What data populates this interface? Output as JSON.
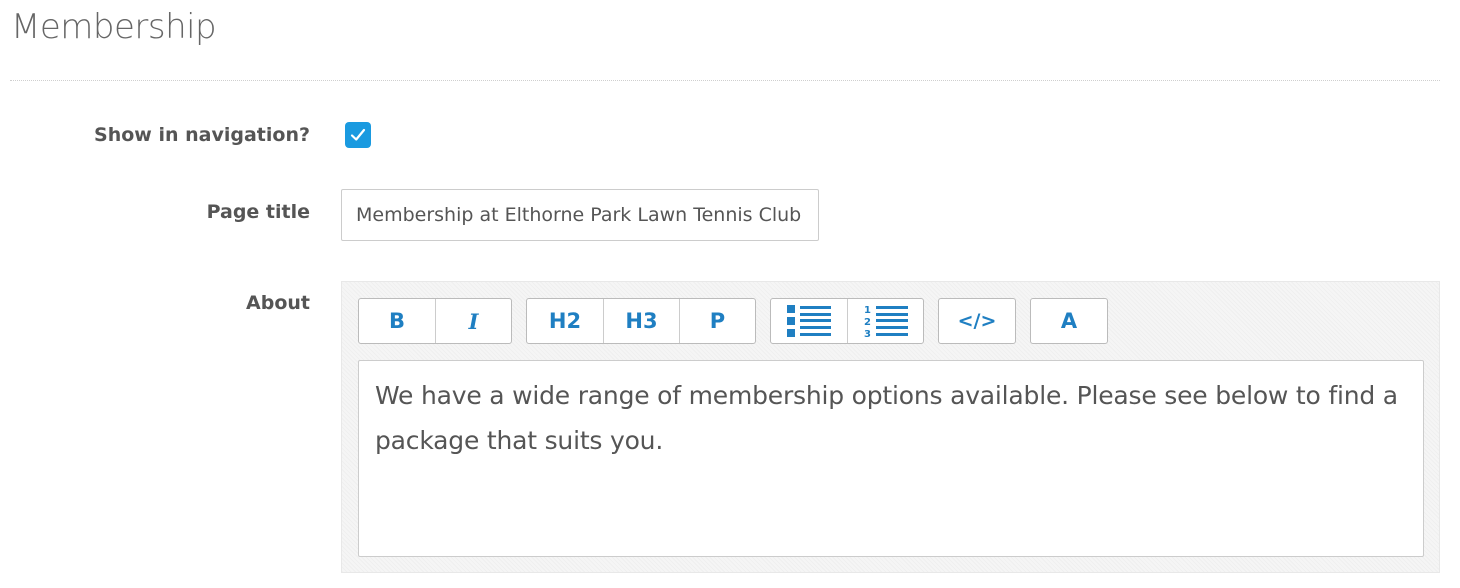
{
  "header": {
    "title": "Membership"
  },
  "form": {
    "show_in_nav": {
      "label": "Show in navigation?",
      "checked": true
    },
    "page_title": {
      "label": "Page title",
      "value": "Membership at Elthorne Park Lawn Tennis Club"
    },
    "about": {
      "label": "About",
      "content": "We have a wide range of membership options available. Please see below to find a package that suits you."
    }
  },
  "toolbar": {
    "bold_label": "B",
    "italic_label": "I",
    "h2_label": "H2",
    "h3_label": "H3",
    "p_label": "P",
    "bullet_list_icon": "bulleted-list-icon",
    "numbered_list_icon": "numbered-list-icon",
    "code_label": "</>",
    "link_label": "A"
  },
  "colors": {
    "accent": "#1f7fc2",
    "checkbox": "#1a9ae0"
  }
}
